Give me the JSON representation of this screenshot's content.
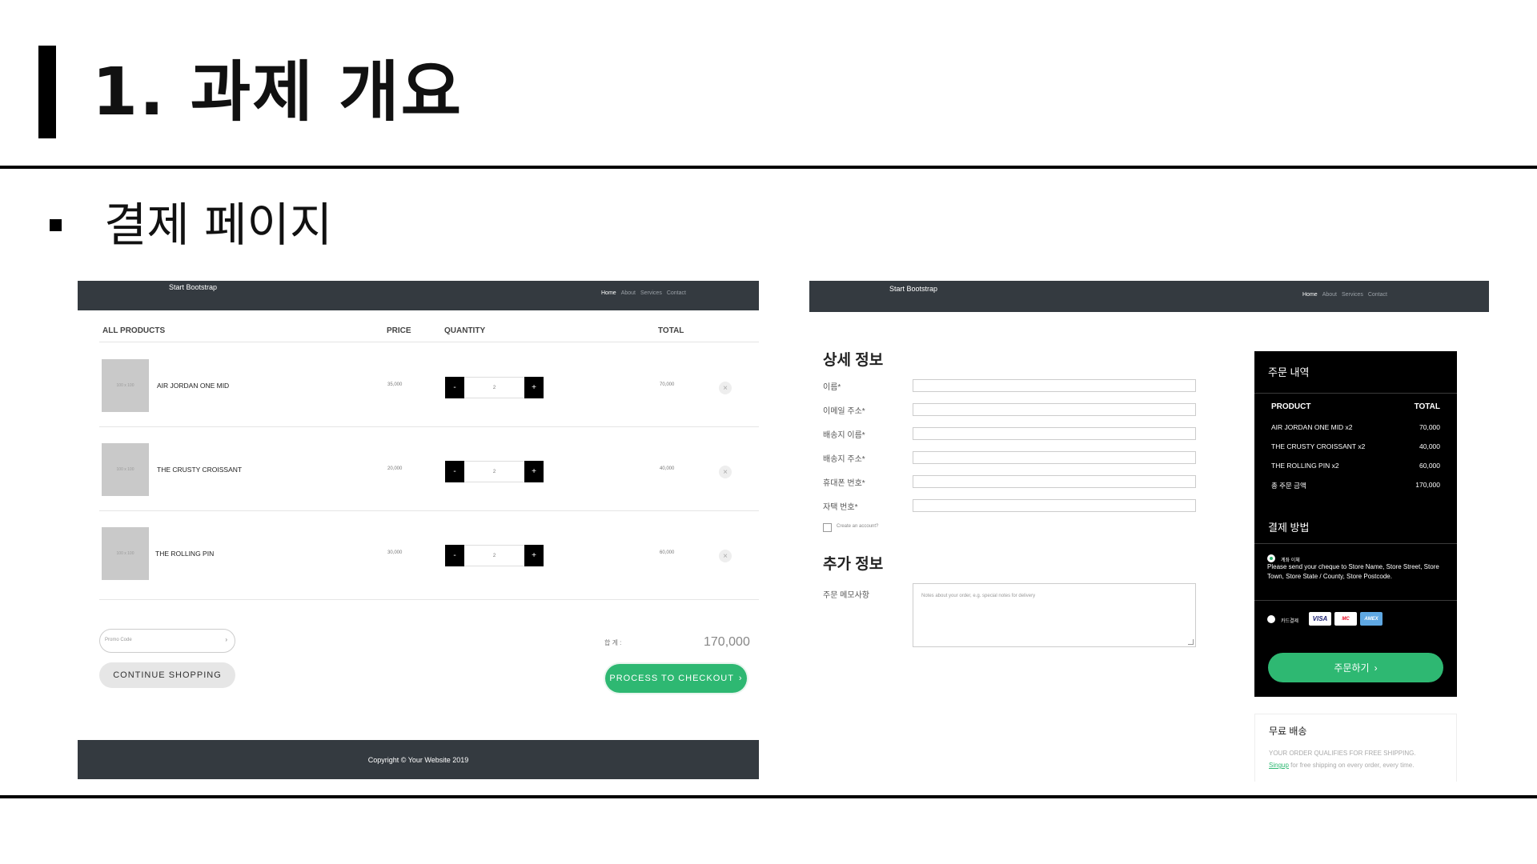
{
  "slide": {
    "title": "1. 과제 개요",
    "subtitle": "결제 페이지"
  },
  "cart_page": {
    "nav": {
      "brand": "Start Bootstrap",
      "links": [
        "Home",
        "About",
        "Services",
        "Contact"
      ]
    },
    "table_headers": [
      "ALL PRODUCTS",
      "PRICE",
      "QUANTITY",
      "TOTAL"
    ],
    "items": [
      {
        "thumb": "100 x 100",
        "name": "AIR JORDAN ONE MID",
        "price": "35,000",
        "qty": "2",
        "total": "70,000"
      },
      {
        "thumb": "100 x 100",
        "name": "THE CRUSTY CROISSANT",
        "price": "20,000",
        "qty": "2",
        "total": "40,000"
      },
      {
        "thumb": "100 x 100",
        "name": "THE ROLLING PIN",
        "price": "30,000",
        "qty": "2",
        "total": "60,000"
      }
    ],
    "qty_minus": "-",
    "qty_plus": "+",
    "remove_icon": "×",
    "promo_placeholder": "Promo Code",
    "promo_arrow": "›",
    "continue_label": "CONTINUE SHOPPING",
    "sum_label": "합 계 :",
    "sum_value": "170,000",
    "checkout_label": "PROCESS TO CHECKOUT",
    "checkout_arrow": "›",
    "footer": "Copyright © Your Website 2019"
  },
  "checkout_page": {
    "nav": {
      "brand": "Start Bootstrap",
      "links": [
        "Home",
        "About",
        "Services",
        "Contact"
      ]
    },
    "details_title": "상세 정보",
    "fields": [
      "이름*",
      "이메일 주소*",
      "배송지 이름*",
      "배송지 주소*",
      "휴대폰 번호*",
      "자택 번호*"
    ],
    "create_account": "Create an account?",
    "extra_title": "추가 정보",
    "memo_label": "주문 메모사항",
    "memo_placeholder": "Notes about your order, e.g. special notes for delivery",
    "order_summary": {
      "title": "주문 내역",
      "col_product": "PRODUCT",
      "col_total": "TOTAL",
      "rows": [
        {
          "name": "AIR JORDAN ONE MID x2",
          "amount": "70,000"
        },
        {
          "name": "THE CRUSTY CROISSANT x2",
          "amount": "40,000"
        },
        {
          "name": "THE ROLLING PIN x2",
          "amount": "60,000"
        },
        {
          "name": "총 주문 금액",
          "amount": "170,000"
        }
      ],
      "payment_title": "결제 방법",
      "option_transfer": "계좌 이체",
      "transfer_desc": "Please send your cheque to Store Name, Store Street, Store Town, Store State / County, Store Postcode.",
      "option_card": "카드결제",
      "cards": [
        "VISA",
        "MC",
        "AMEX"
      ],
      "order_button": "주문하기",
      "order_arrow": "›"
    },
    "shipping": {
      "title": "무료 배송",
      "line1": "YOUR ORDER QUALIFIES FOR FREE SHIPPING.",
      "link": "Singup",
      "line2": " for free shipping on every order, every time."
    }
  },
  "colors": {
    "accent": "#2eb872",
    "navbar": "#343a40",
    "order_box": "#000000"
  }
}
